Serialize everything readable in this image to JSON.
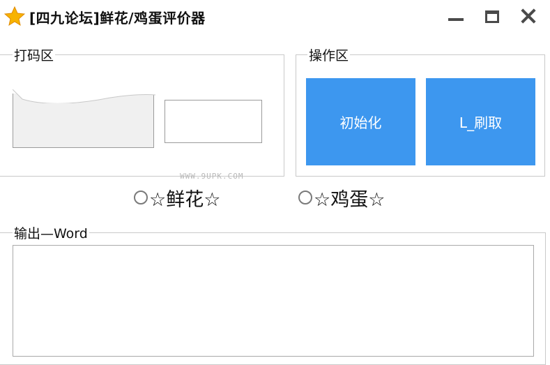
{
  "window": {
    "title": "[四九论坛]鲜花/鸡蛋评价器",
    "icon": "star-icon"
  },
  "captcha_group": {
    "label": "打码区"
  },
  "ops_group": {
    "label": "操作区",
    "buttons": [
      "初始化",
      "L_刷取"
    ],
    "button_color": "#3d97ef"
  },
  "watermark": "WWW.9UPK.COM",
  "options": [
    "☆鲜花☆",
    "☆鸡蛋☆"
  ],
  "output_group": {
    "label": "输出—Word"
  }
}
